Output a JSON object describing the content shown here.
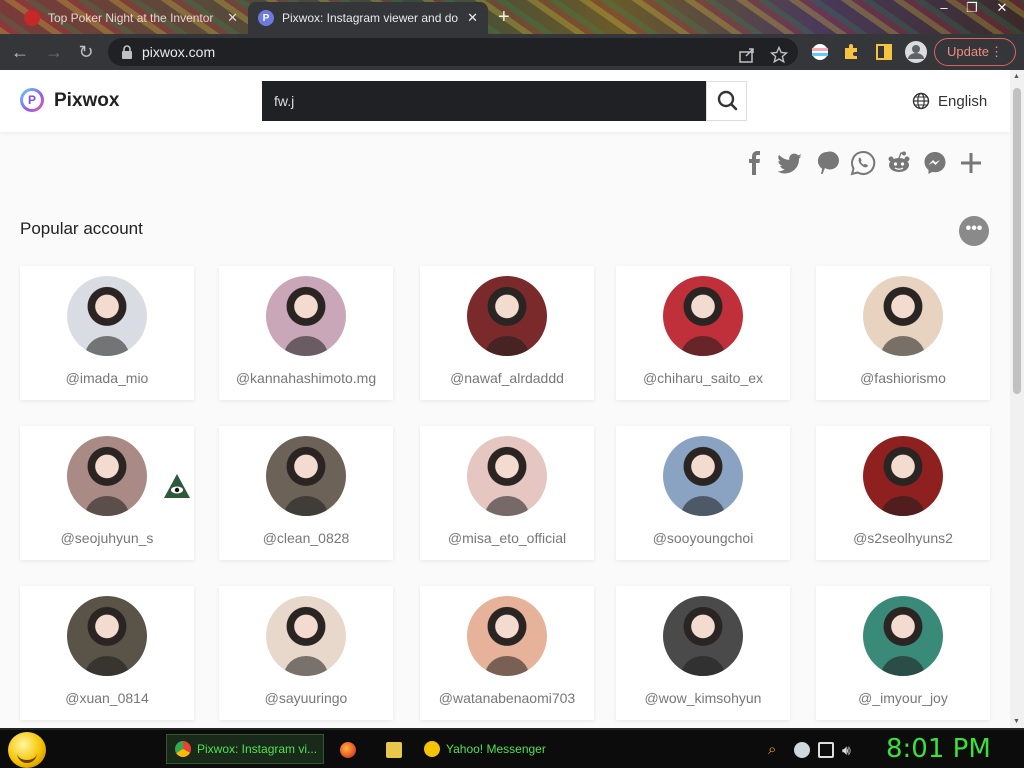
{
  "browser": {
    "tabs": [
      {
        "title": "Top Poker Night at the Inventor",
        "active": false
      },
      {
        "title": "Pixwox: Instagram viewer and do",
        "active": true
      }
    ],
    "url": "pixwox.com",
    "update_label": "Update"
  },
  "site": {
    "logo": "Pixwox",
    "search_value": "fw.j",
    "language": "English",
    "share_icons": [
      "facebook-icon",
      "twitter-icon",
      "pinterest-icon",
      "whatsapp-icon",
      "reddit-icon",
      "messenger-icon",
      "plus-icon"
    ]
  },
  "popular": {
    "title": "Popular account",
    "accounts": [
      {
        "handle": "@imada_mio",
        "color": "#d9dde3"
      },
      {
        "handle": "@kannahashimoto.mg",
        "color": "#c9a7b8"
      },
      {
        "handle": "@nawaf_alrdaddd",
        "color": "#7a2a2a"
      },
      {
        "handle": "@chiharu_saito_ex",
        "color": "#c0303a"
      },
      {
        "handle": "@fashiorismo",
        "color": "#e7d3c0"
      },
      {
        "handle": "@seojuhyun_s",
        "color": "#a98a84"
      },
      {
        "handle": "@clean_0828",
        "color": "#6c6258"
      },
      {
        "handle": "@misa_eto_official",
        "color": "#e5c6c0"
      },
      {
        "handle": "@sooyoungchoi",
        "color": "#8aa3c2"
      },
      {
        "handle": "@s2seolhyuns2",
        "color": "#8e2020"
      },
      {
        "handle": "@xuan_0814",
        "color": "#5a5348"
      },
      {
        "handle": "@sayuuringo",
        "color": "#e8d8cc"
      },
      {
        "handle": "@watanabenaomi703",
        "color": "#e6b29a"
      },
      {
        "handle": "@wow_kimsohyun",
        "color": "#4a4a4a"
      },
      {
        "handle": "@_imyour_joy",
        "color": "#3a8a7a"
      }
    ]
  },
  "taskbar": {
    "tasks": [
      {
        "label": "Pixwox: Instagram vi..."
      },
      {
        "label": "Yahoo! Messenger"
      }
    ],
    "clock": "8:01 PM"
  },
  "colors": {
    "accent_update": "#f28b82",
    "clock_green": "#3ddf3d",
    "search_bg": "#202124"
  }
}
